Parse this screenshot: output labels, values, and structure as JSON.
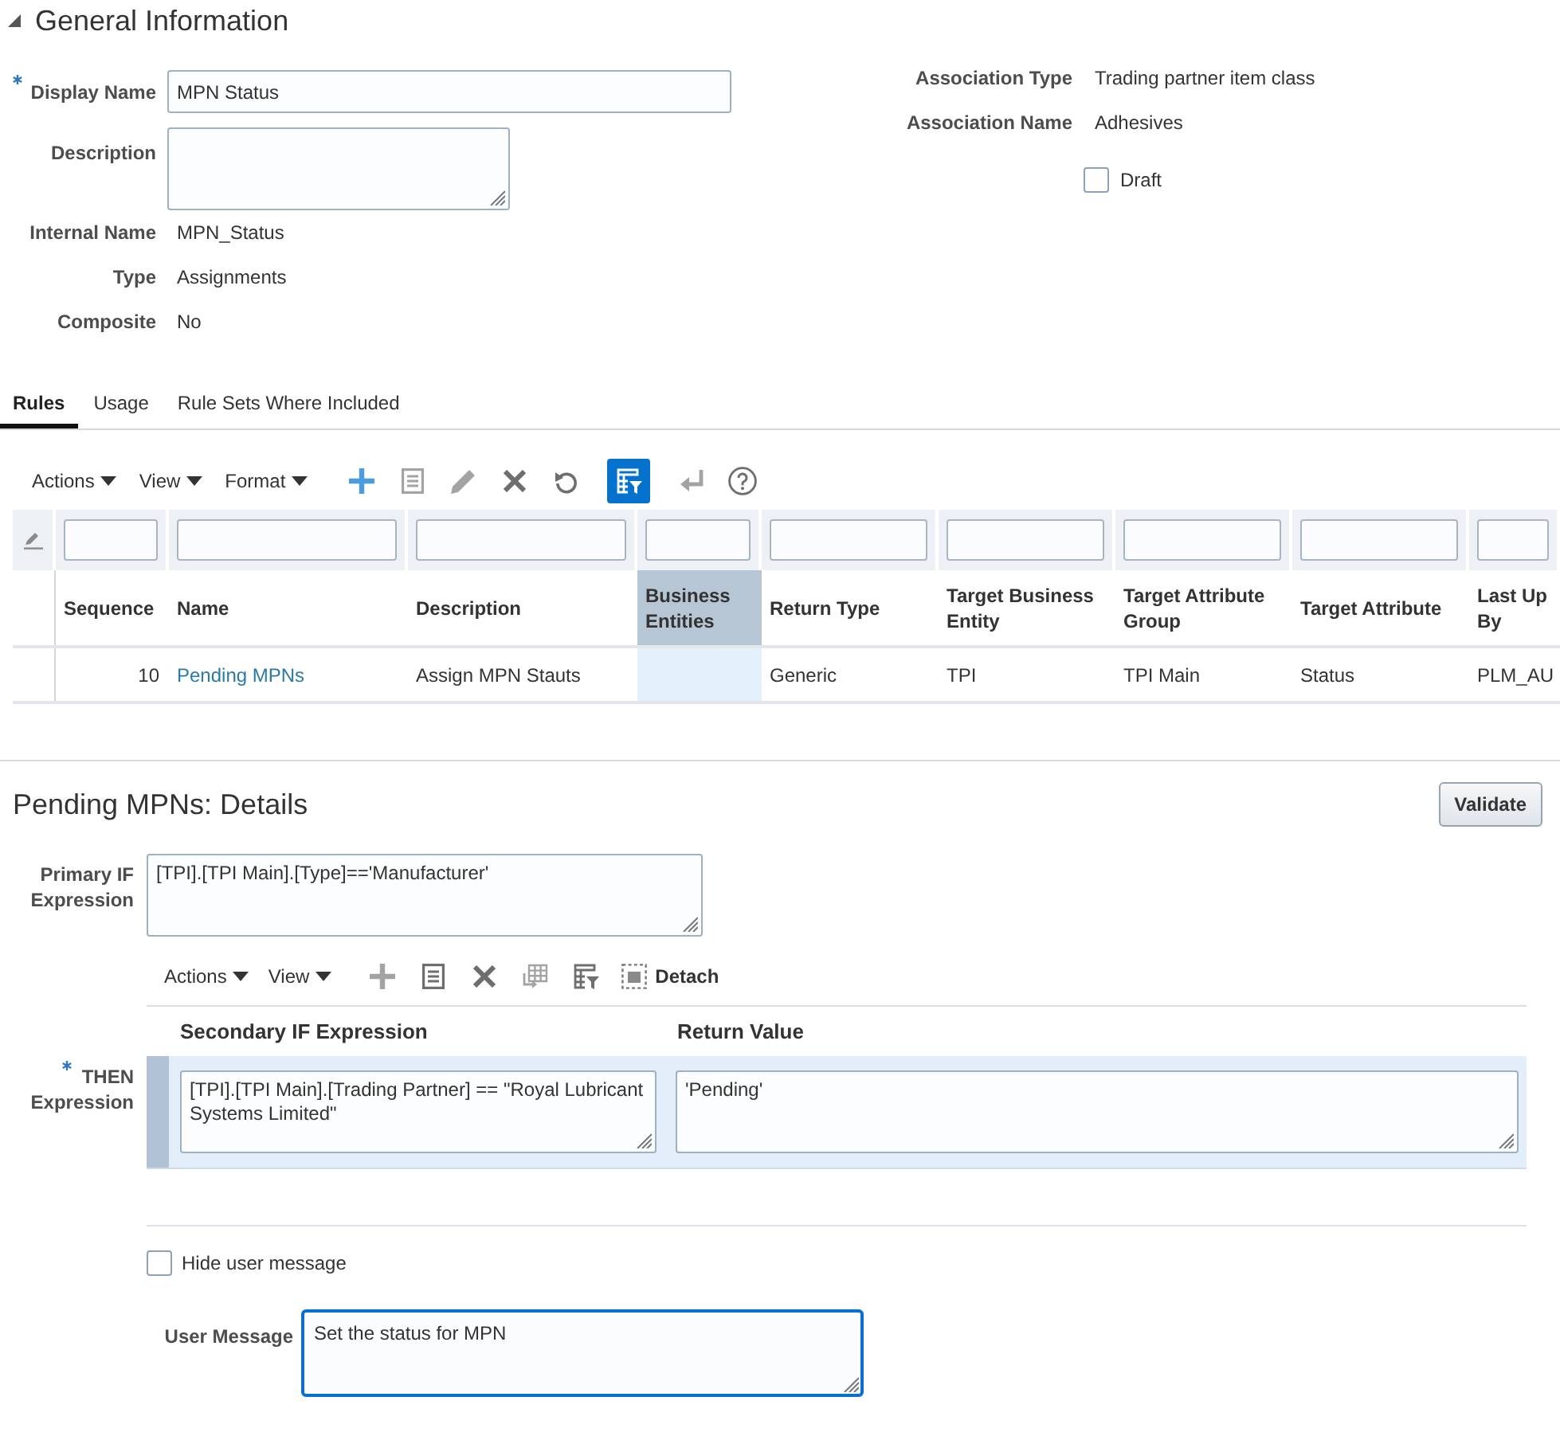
{
  "general": {
    "title": "General Information",
    "expanded": true,
    "fields": [
      {
        "kind": "input",
        "label": "Display Name",
        "required": true,
        "value": "MPN Status"
      },
      {
        "kind": "textarea",
        "label": "Description",
        "required": false
      },
      {
        "kind": "text",
        "label": "Internal Name",
        "required": false,
        "value": "MPN_Status"
      },
      {
        "kind": "text",
        "label": "Type",
        "required": false,
        "value": "Assignments"
      },
      {
        "kind": "text",
        "label": "Composite",
        "required": false,
        "value": "No"
      }
    ],
    "association": [
      {
        "label": "Association Type",
        "value": "Trading partner item class"
      },
      {
        "label": "Association Name",
        "value": "Adhesives"
      }
    ],
    "draft": {
      "label": "Draft",
      "checked": false
    }
  },
  "tabs": [
    {
      "label": "Rules",
      "selected": true
    },
    {
      "label": "Usage",
      "selected": false
    },
    {
      "label": "Rule Sets Where Included",
      "selected": false
    }
  ],
  "rules_toolbar": {
    "menus": [
      "Actions",
      "View",
      "Format"
    ],
    "tools": [
      {
        "kind": "add",
        "disabled": false,
        "selected": false
      },
      {
        "kind": "list",
        "disabled": true,
        "selected": false
      },
      {
        "kind": "edit",
        "disabled": true,
        "selected": false
      },
      {
        "kind": "delete",
        "disabled": false,
        "selected": false
      },
      {
        "kind": "refresh",
        "disabled": false,
        "selected": false
      },
      {
        "kind": "filter",
        "disabled": false,
        "selected": true
      },
      {
        "kind": "enter",
        "disabled": true,
        "selected": false
      },
      {
        "kind": "help",
        "disabled": false,
        "selected": false
      }
    ]
  },
  "rules_table": {
    "columns": [
      {
        "label": "Sequence",
        "selected": false
      },
      {
        "label": "Name",
        "selected": false
      },
      {
        "label": "Description",
        "selected": false
      },
      {
        "label": "Business Entities",
        "selected": true
      },
      {
        "label": "Return Type",
        "selected": false
      },
      {
        "label": "Target Business Entity",
        "selected": false
      },
      {
        "label": "Target Attribute Group",
        "selected": false
      },
      {
        "label": "Target Attribute",
        "selected": false
      },
      {
        "label": "Last Up By",
        "selected": false
      }
    ],
    "rows": [
      {
        "selected": false,
        "cells": [
          {
            "kind": "number",
            "text": "10"
          },
          {
            "kind": "link",
            "text": "Pending MPNs"
          },
          {
            "kind": "text",
            "text": "Assign MPN Stauts"
          },
          {
            "kind": "empty"
          },
          {
            "kind": "text",
            "text": "Generic"
          },
          {
            "kind": "text",
            "text": "TPI"
          },
          {
            "kind": "text",
            "text": "TPI Main"
          },
          {
            "kind": "text",
            "text": "Status"
          },
          {
            "kind": "text",
            "text": "PLM_AU"
          }
        ]
      }
    ]
  },
  "details": {
    "title": "Pending MPNs: Details",
    "validate_button": "Validate",
    "primary_if": {
      "label": "Primary IF Expression",
      "value": "[TPI].[TPI Main].[Type]=='Manufacturer'"
    },
    "toolbar": {
      "menus": [
        "Actions",
        "View"
      ],
      "tools": [
        {
          "kind": "add",
          "disabled": true,
          "selected": false
        },
        {
          "kind": "list",
          "disabled": false,
          "selected": false
        },
        {
          "kind": "delete",
          "disabled": false,
          "selected": false
        },
        {
          "kind": "table",
          "disabled": true,
          "selected": false
        },
        {
          "kind": "filter",
          "disabled": false,
          "selected": false
        }
      ],
      "detach": "Detach"
    },
    "then": {
      "label": "THEN Expression",
      "required": true,
      "columns": [
        "Secondary IF Expression",
        "Return Value"
      ],
      "rows": [
        {
          "selected": true,
          "cells": [
            "[TPI].[TPI Main].[Trading Partner] == \"Royal Lubricant Systems Limited\"",
            "'Pending'"
          ]
        }
      ]
    },
    "hide_message": {
      "label": "Hide user message",
      "checked": false
    },
    "user_message": {
      "label": "User Message",
      "value": "Set the status for MPN",
      "focused": true
    }
  }
}
